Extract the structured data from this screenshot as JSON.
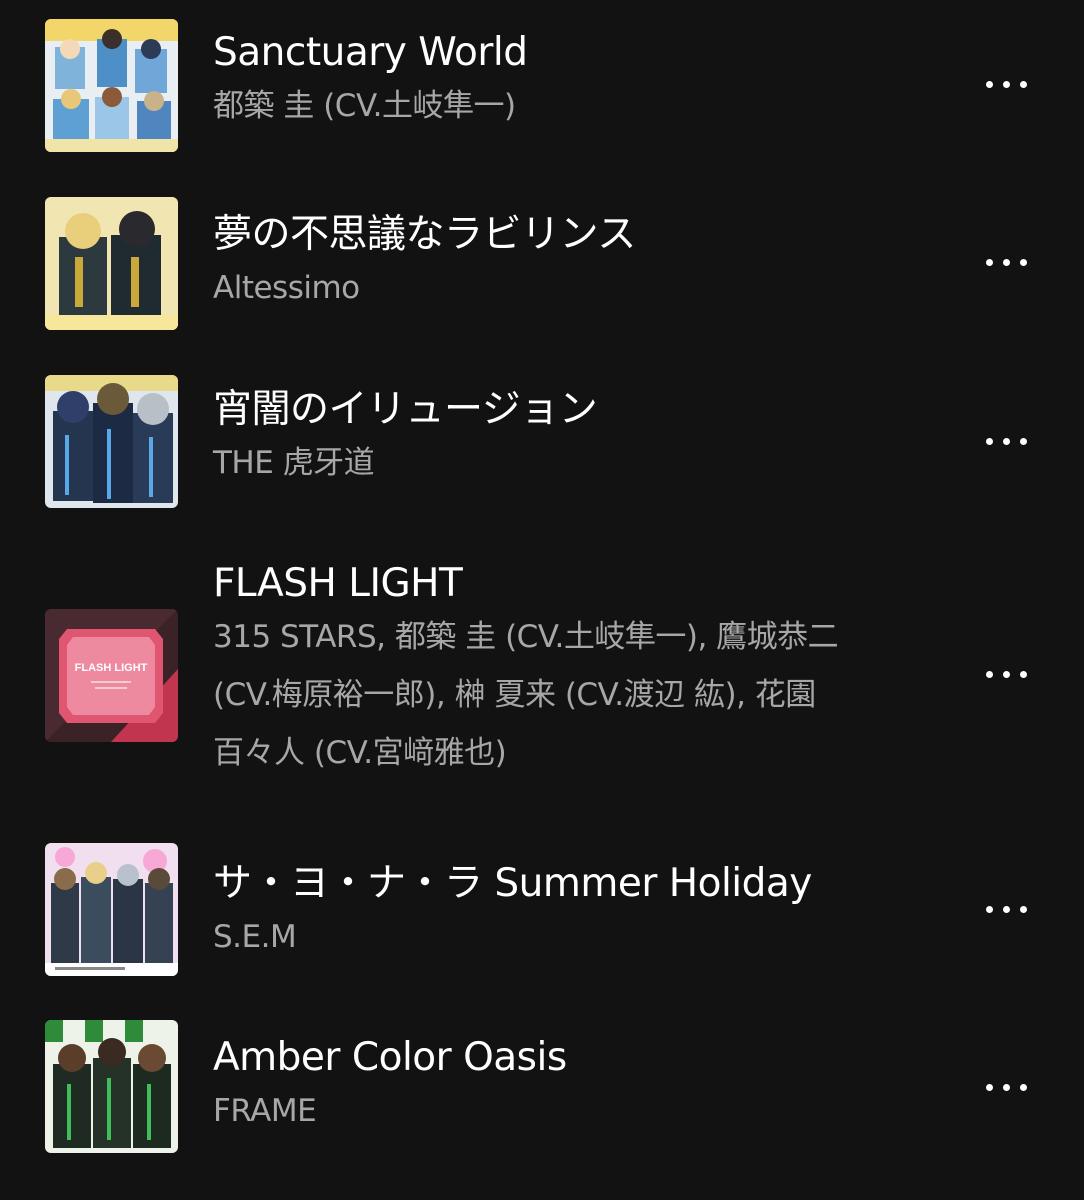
{
  "tracks": [
    {
      "title": "Sanctuary World",
      "artist": "都築 圭 (CV.土岐隼一)",
      "cover": "anime-group-cover-light-blue"
    },
    {
      "title": "夢の不思議なラビリンス",
      "artist": "Altessimo",
      "cover": "anime-duo-cover-yellow"
    },
    {
      "title": "宵闇のイリュージョン",
      "artist": "THE 虎牙道",
      "cover": "anime-trio-cover-blue"
    },
    {
      "title": "FLASH LIGHT",
      "artist_lines": [
        "315 STARS, 都築 圭 (CV.土岐隼一), 鷹城恭二",
        "(CV.梅原裕一郎), 榊 夏来 (CV.渡辺 紘), 花園",
        "百々人 (CV.宮﨑雅也)"
      ],
      "cover": "flash-light-pink-cover",
      "cover_text": "FLASH LIGHT"
    },
    {
      "title": "サ・ヨ・ナ・ラ Summer Holiday",
      "artist": "S.E.M",
      "cover": "anime-group-cover-pink"
    },
    {
      "title": "Amber Color Oasis",
      "artist": "FRAME",
      "cover": "anime-trio-cover-green"
    }
  ],
  "more_icon": "more-dots-icon"
}
